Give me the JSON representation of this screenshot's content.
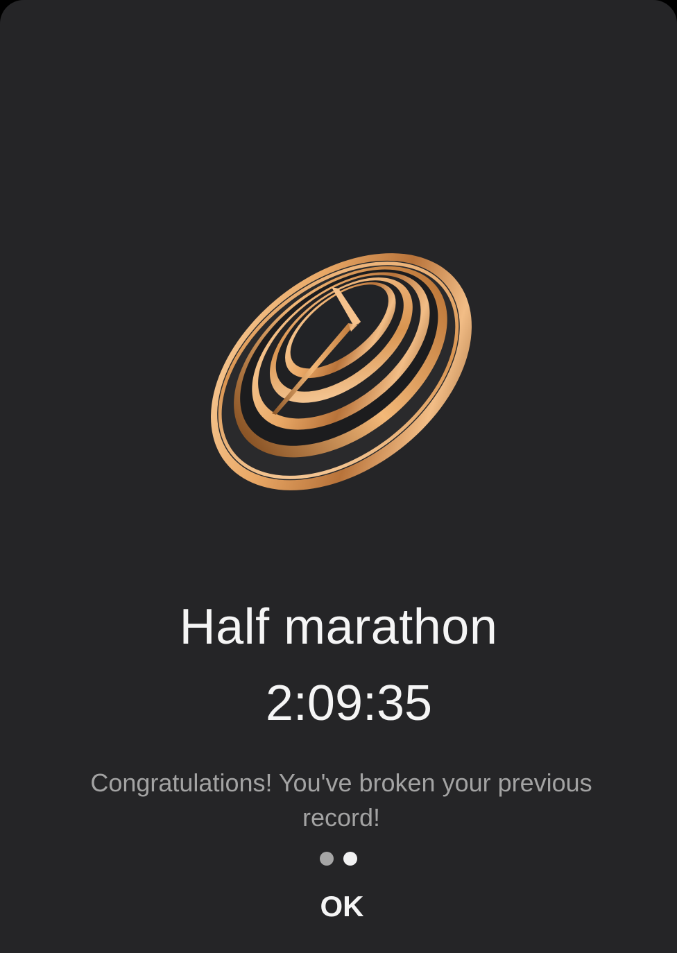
{
  "badge": {
    "icon": "gold-clock-medal-icon",
    "colors": {
      "gold_light": "#f9c995",
      "gold_mid": "#e7a35f",
      "gold_dark": "#8a5426",
      "face": "#222326"
    }
  },
  "record": {
    "title": "Half marathon",
    "time": "2:09:35",
    "message": "Congratulations! You've broken your previous record!"
  },
  "pager": {
    "count": 2,
    "active_index": 1
  },
  "actions": {
    "ok_label": "OK"
  },
  "colors": {
    "background": "#252527",
    "text_primary": "#f5f5f5",
    "text_secondary": "#a3a3a3"
  }
}
